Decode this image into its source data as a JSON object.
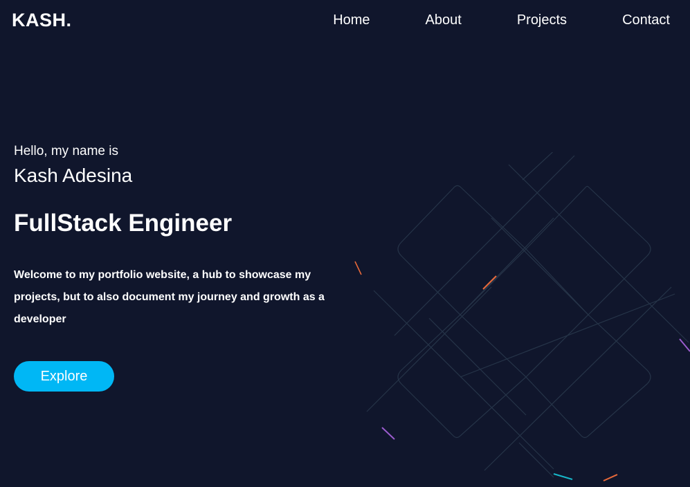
{
  "header": {
    "logo": "KASH.",
    "nav": [
      "Home",
      "About",
      "Projects",
      "Contact"
    ]
  },
  "hero": {
    "greeting": "Hello, my name is",
    "name": "Kash Adesina",
    "role": "FullStack Engineer",
    "intro": "Welcome to my portfolio website, a hub to showcase my projects, but to also document my journey and growth as a developer",
    "cta_label": "Explore"
  },
  "colors": {
    "background": "#10162c",
    "accent": "#00b7f5",
    "text": "#ffffff"
  }
}
